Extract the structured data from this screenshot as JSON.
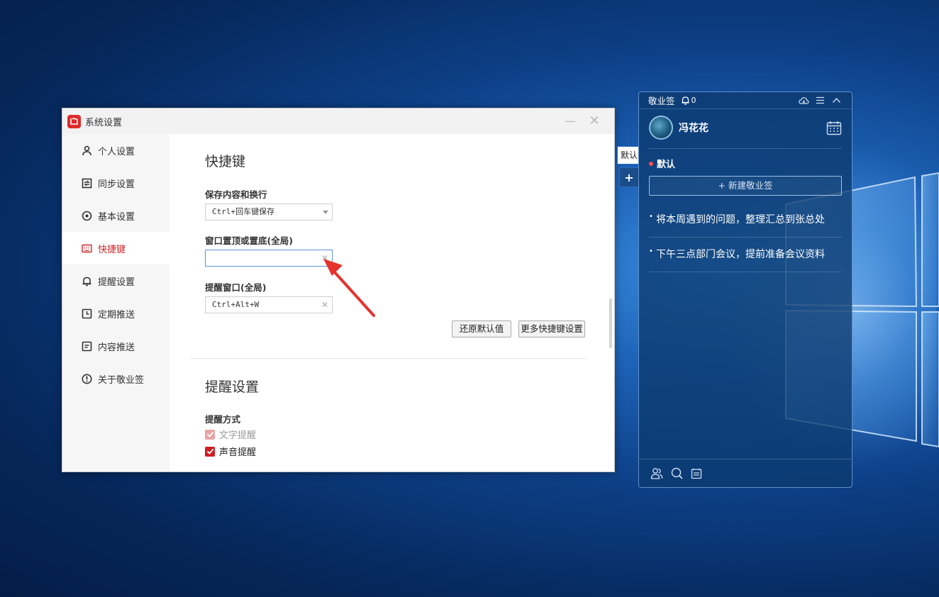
{
  "settings_window": {
    "title": "系统设置",
    "sidebar": [
      {
        "label": "个人设置",
        "icon": "user-icon",
        "active": false
      },
      {
        "label": "同步设置",
        "icon": "sync-icon",
        "active": false
      },
      {
        "label": "基本设置",
        "icon": "gear-icon",
        "active": false
      },
      {
        "label": "快捷键",
        "icon": "keyboard-icon",
        "active": true
      },
      {
        "label": "提醒设置",
        "icon": "bell-icon",
        "active": false
      },
      {
        "label": "定期推送",
        "icon": "clock-icon",
        "active": false
      },
      {
        "label": "内容推送",
        "icon": "document-icon",
        "active": false
      },
      {
        "label": "关于敬业签",
        "icon": "info-icon",
        "active": false
      }
    ],
    "shortcuts": {
      "title": "快捷键",
      "save_label": "保存内容和换行",
      "save_value": "Ctrl+回车键保存",
      "pin_label": "窗口置顶或置底(全局)",
      "pin_value": "",
      "remind_label": "提醒窗口(全局)",
      "remind_value": "Ctrl+Alt+W",
      "restore_button": "还原默认值",
      "more_button": "更多快捷键设置"
    },
    "reminder": {
      "title": "提醒设置",
      "method_label": "提醒方式",
      "text_reminder": "文字提醒",
      "sound_reminder": "声音提醒"
    }
  },
  "side_tabs": {
    "default_tab": "默认",
    "add_tab": "+"
  },
  "note_panel": {
    "app_name": "敬业签",
    "notification_count": "0",
    "username": "冯花花",
    "group_name": "默认",
    "new_note_button": "+ 新建敬业签",
    "notes": [
      "将本周遇到的问题，整理汇总到张总处",
      "下午三点部门会议，提前准备会议资料"
    ]
  },
  "colors": {
    "accent_red": "#c8282a",
    "focus_blue": "#5d8fd9",
    "panel_bg": "#0c3a6e"
  }
}
